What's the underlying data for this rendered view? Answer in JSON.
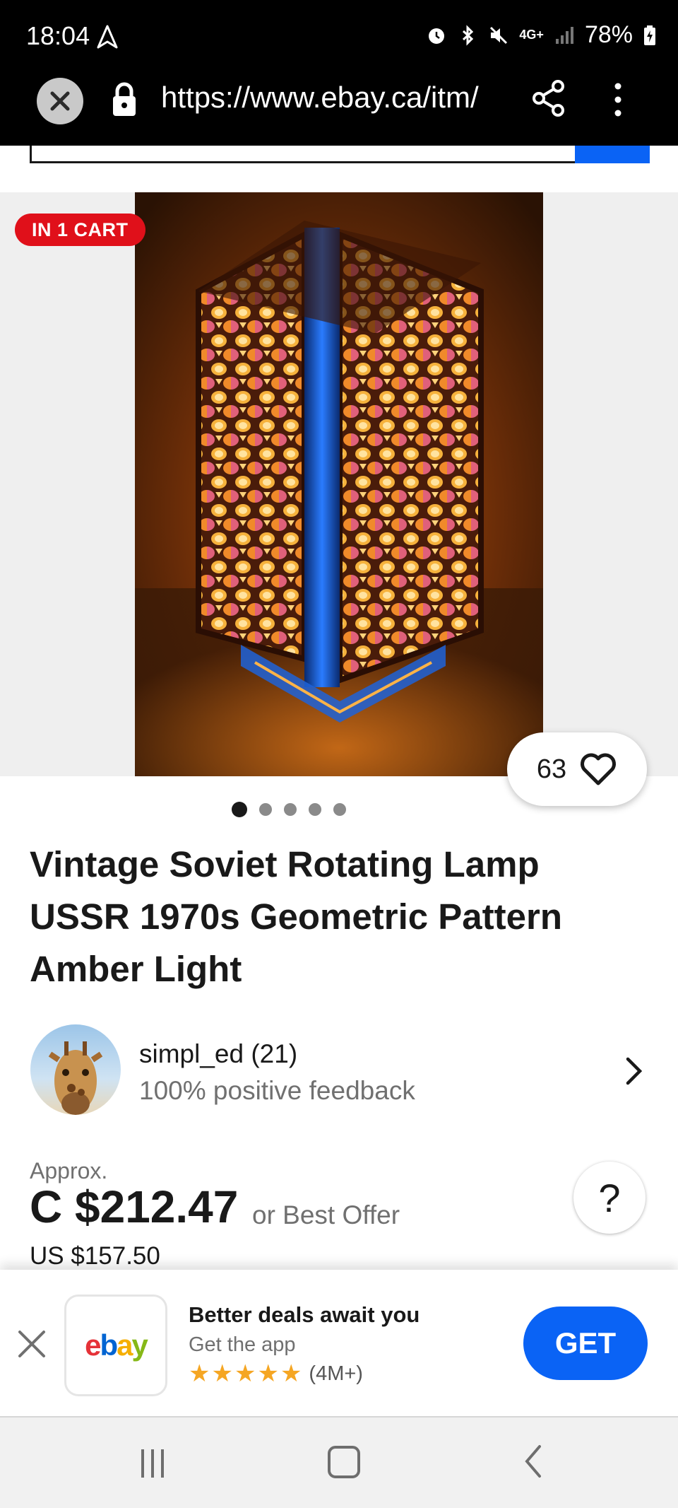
{
  "status_bar": {
    "time": "18:04",
    "network": "4G+",
    "battery": "78%"
  },
  "browser": {
    "url": "https://www.ebay.ca/itm/"
  },
  "listing": {
    "cart_badge": "IN 1 CART",
    "watch_count": "63",
    "image_pages": 5,
    "image_current": 1,
    "title": "Vintage Soviet Rotating Lamp USSR 1970s Geometric Pattern Amber Light"
  },
  "seller": {
    "name": "simpl_ed (21)",
    "feedback": "100% positive feedback"
  },
  "price": {
    "approx_label": "Approx.",
    "amount": "C $212.47",
    "offer": "or Best Offer",
    "usd": "US $157.50"
  },
  "help": {
    "label": "?"
  },
  "app_banner": {
    "title": "Better deals await you",
    "subtitle": "Get the app",
    "rating_stars": 5,
    "rating_count": "(4M+)",
    "get_label": "GET",
    "logo": "ebay"
  },
  "colors": {
    "brand_blue": "#0a63f5",
    "badge_red": "#e0101a",
    "ebay_e": "#e53238",
    "ebay_b": "#0064d2",
    "ebay_a": "#f5af02",
    "ebay_y": "#86b817"
  },
  "icons": [
    "close-icon",
    "lock-icon",
    "share-icon",
    "more-vert-icon",
    "heart-icon",
    "chevron-right-icon",
    "star-icon",
    "recents-icon",
    "home-icon",
    "back-icon"
  ]
}
